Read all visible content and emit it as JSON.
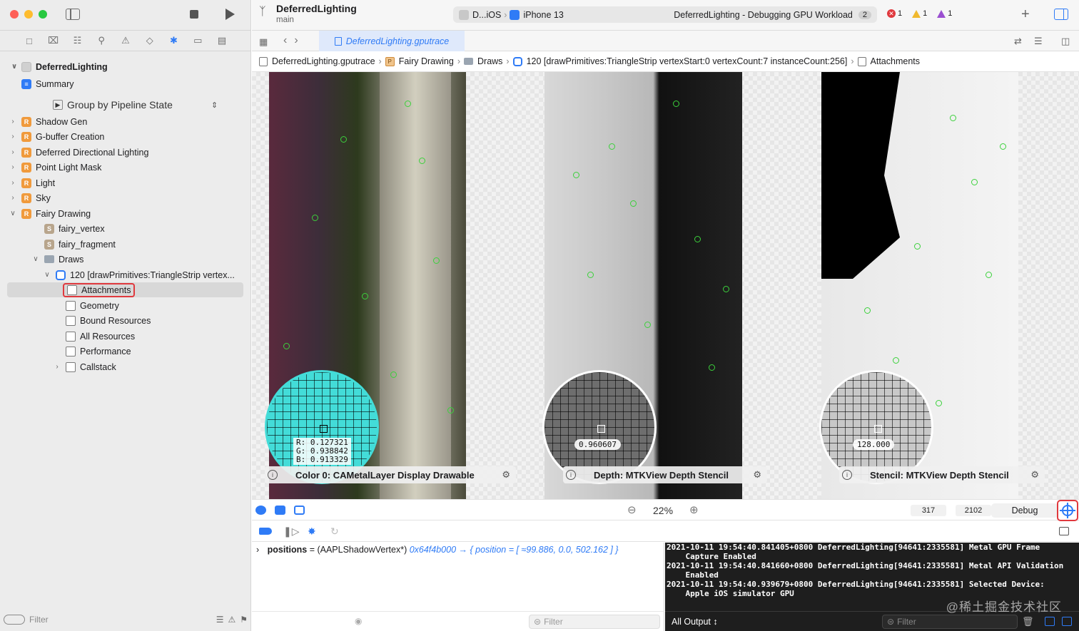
{
  "window": {
    "project_name": "DeferredLighting",
    "branch": "main",
    "scheme": "D...iOS",
    "device": "iPhone 13",
    "status_text": "DeferredLighting - Debugging GPU Workload",
    "status_count": "2",
    "errors": "1",
    "warnings": "1",
    "runtime_issues": "1"
  },
  "sidebar": {
    "root": "DeferredLighting",
    "summary": "Summary",
    "group_by": "Group by Pipeline State",
    "passes": [
      {
        "label": "Shadow Gen",
        "badge": "R"
      },
      {
        "label": "G-buffer Creation",
        "badge": "R"
      },
      {
        "label": "Deferred Directional Lighting",
        "badge": "R"
      },
      {
        "label": "Point Light Mask",
        "badge": "R"
      },
      {
        "label": "Light",
        "badge": "R"
      },
      {
        "label": "Sky",
        "badge": "R"
      },
      {
        "label": "Fairy Drawing",
        "badge": "R"
      }
    ],
    "shaders": [
      {
        "label": "fairy_vertex",
        "badge": "S"
      },
      {
        "label": "fairy_fragment",
        "badge": "S"
      }
    ],
    "draws_folder": "Draws",
    "draw_call": "120 [drawPrimitives:TriangleStrip vertex...",
    "draw_children": [
      "Attachments",
      "Geometry",
      "Bound Resources",
      "All Resources",
      "Performance",
      "Callstack"
    ],
    "filter_placeholder": "Filter"
  },
  "tab": {
    "label": "DeferredLighting.gputrace"
  },
  "jumpbar": {
    "file": "DeferredLighting.gputrace",
    "pipeline": "Fairy Drawing",
    "folder": "Draws",
    "draw": "120 [drawPrimitives:TriangleStrip vertexStart:0 vertexCount:7 instanceCount:256]",
    "current": "Attachments"
  },
  "attachments": {
    "color": {
      "label": "Color 0: CAMetalLayer Display Drawable",
      "r": "R:   0.127321",
      "g": "G:   0.938842",
      "b": "B:   0.913329",
      "swatch": "#43dcd8"
    },
    "depth": {
      "label": "Depth: MTKView Depth Stencil",
      "value": "0.960607"
    },
    "stencil": {
      "label": "Stencil: MTKView Depth Stencil",
      "value": "128.000"
    }
  },
  "canvas_toolbar": {
    "zoom": "22%",
    "x": "317",
    "y": "2102",
    "mode": "Debug"
  },
  "variables": {
    "name": "positions",
    "eq": " = (AAPLShadowVertex*) ",
    "value": "0x64f4b000 → { position = [ ≈99.886, 0.0, 502.162 ] }",
    "filter_placeholder": "Filter"
  },
  "console": {
    "lines": "2021-10-11 19:54:40.841405+0800 DeferredLighting[94641:2335581] Metal GPU Frame\n    Capture Enabled\n2021-10-11 19:54:40.841660+0800 DeferredLighting[94641:2335581] Metal API Validation\n    Enabled\n2021-10-11 19:54:40.939679+0800 DeferredLighting[94641:2335581] Selected Device:\n    Apple iOS simulator GPU",
    "output_selector": "All Output ↕",
    "filter_placeholder": "Filter",
    "watermark": "@稀土掘金技术社区"
  }
}
